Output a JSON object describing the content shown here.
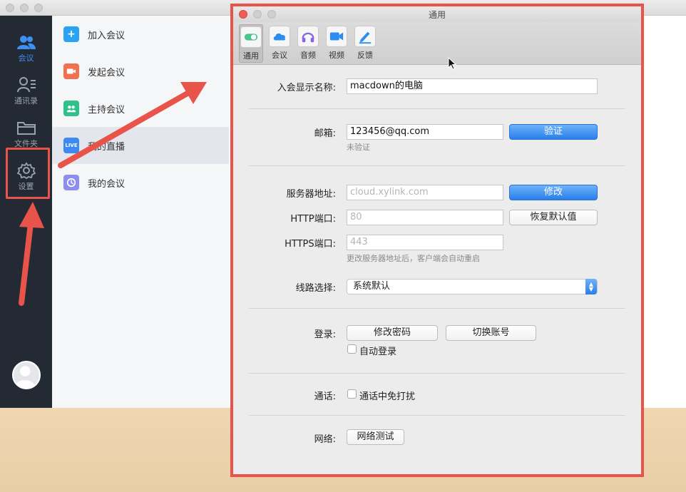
{
  "app": {
    "nav": [
      {
        "label": "会议",
        "icon": "people-icon",
        "active": true
      },
      {
        "label": "通讯录",
        "icon": "contacts-icon",
        "active": false
      },
      {
        "label": "文件夹",
        "icon": "folder-icon",
        "active": false
      },
      {
        "label": "设置",
        "icon": "gear-icon",
        "active": false
      }
    ],
    "menu": [
      {
        "label": "加入会议",
        "icon": "plus-icon",
        "color": "#2aa3f3"
      },
      {
        "label": "发起会议",
        "icon": "camera-add-icon",
        "color": "#f0704f"
      },
      {
        "label": "主持会议",
        "icon": "host-icon",
        "color": "#2ec28a"
      },
      {
        "label": "我的直播",
        "icon": "live-icon",
        "color": "#3d8bf2",
        "badge": "LIVE"
      },
      {
        "label": "我的会议",
        "icon": "clock-icon",
        "color": "#8e8df0"
      }
    ]
  },
  "dialog": {
    "title": "通用",
    "tabs": [
      {
        "label": "通用",
        "icon": "toggle-icon",
        "active": true
      },
      {
        "label": "会议",
        "icon": "cloud-icon"
      },
      {
        "label": "音频",
        "icon": "headphones-icon"
      },
      {
        "label": "视频",
        "icon": "video-camera-icon"
      },
      {
        "label": "反馈",
        "icon": "pen-icon"
      }
    ],
    "display_name_label": "入会显示名称:",
    "display_name_value": "macdown的电脑",
    "email_label": "邮箱:",
    "email_value": "123456@qq.com",
    "verify_button": "验证",
    "email_status": "未验证",
    "server_label": "服务器地址:",
    "server_placeholder": "cloud.xylink.com",
    "modify_button": "修改",
    "http_label": "HTTP端口:",
    "http_placeholder": "80",
    "restore_button": "恢复默认值",
    "https_label": "HTTPS端口:",
    "https_placeholder": "443",
    "server_hint": "更改服务器地址后，客户端会自动重启",
    "route_label": "线路选择:",
    "route_value": "系统默认",
    "login_label": "登录:",
    "change_password_button": "修改密码",
    "switch_account_button": "切换账号",
    "auto_login_label": "自动登录",
    "call_label": "通话:",
    "dnd_label": "通话中免打扰",
    "network_label": "网络:",
    "network_test_button": "网络测试"
  },
  "colors": {
    "annotation_red": "#e8534a",
    "accent_blue": "#2a7ee8",
    "sidebar_dark": "#242a33"
  }
}
